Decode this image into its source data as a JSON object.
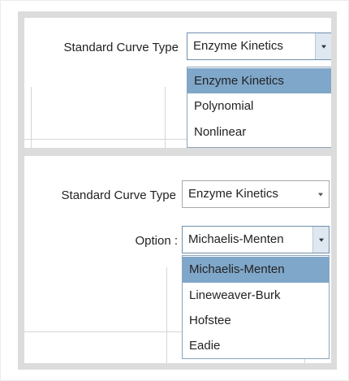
{
  "panel1": {
    "label": "Standard Curve Type",
    "select_value": "Enzyme Kinetics",
    "options": [
      "Enzyme Kinetics",
      "Polynomial",
      "Nonlinear"
    ],
    "selected_index": 0
  },
  "panel2": {
    "label": "Standard Curve Type",
    "select_value": "Enzyme Kinetics",
    "option_label": "Option :",
    "option_value": "Michaelis-Menten",
    "options": [
      "Michaelis-Menten",
      "Lineweaver-Burk",
      "Hofstee",
      "Eadie"
    ],
    "selected_index": 0
  },
  "colors": {
    "highlight": "#7fa7c9",
    "background": "#dcdcdc"
  },
  "icons": {
    "select_arrow": "chevron-down-icon"
  }
}
